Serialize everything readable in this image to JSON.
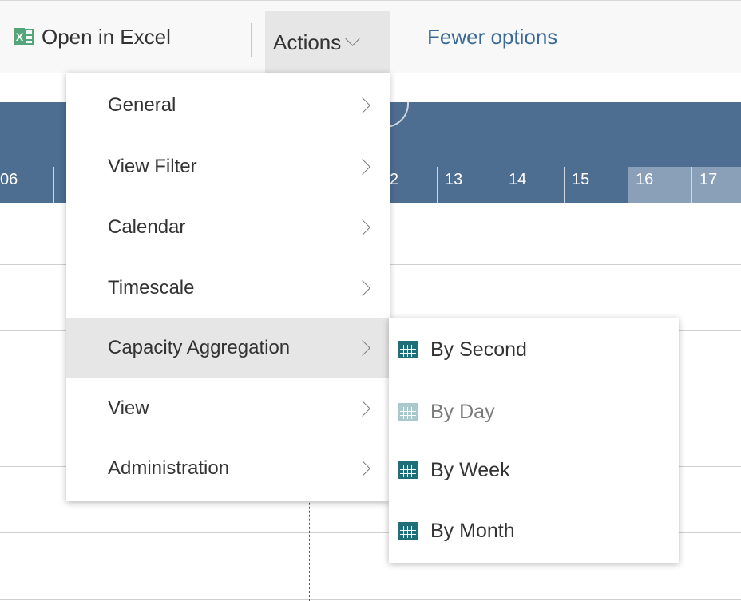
{
  "toolbar": {
    "open_excel_label": "Open in Excel",
    "actions_label": "Actions",
    "fewer_options_label": "Fewer options"
  },
  "calendar": {
    "left_days": [
      "06",
      ""
    ],
    "right_days": [
      "2",
      "13",
      "14",
      "15",
      "16",
      "17"
    ],
    "highlight_days": [
      "16",
      "17"
    ],
    "header_color": "#4d6d91",
    "highlight_color": "#8aa0b8"
  },
  "menu": {
    "items": [
      {
        "label": "General"
      },
      {
        "label": "View Filter"
      },
      {
        "label": "Calendar"
      },
      {
        "label": "Timescale"
      },
      {
        "label": "Capacity Aggregation",
        "active": true
      },
      {
        "label": "View"
      },
      {
        "label": "Administration"
      }
    ]
  },
  "submenu": {
    "items": [
      {
        "label": "By Second",
        "icon": "calendar-grid-icon",
        "enabled": true
      },
      {
        "label": "By Day",
        "icon": "calendar-grid-icon",
        "enabled": false
      },
      {
        "label": "By Week",
        "icon": "calendar-grid-icon",
        "enabled": true
      },
      {
        "label": "By Month",
        "icon": "calendar-grid-icon",
        "enabled": true
      }
    ],
    "icon_color": "#1f6f79",
    "icon_disabled_color": "#a9c9cc"
  }
}
